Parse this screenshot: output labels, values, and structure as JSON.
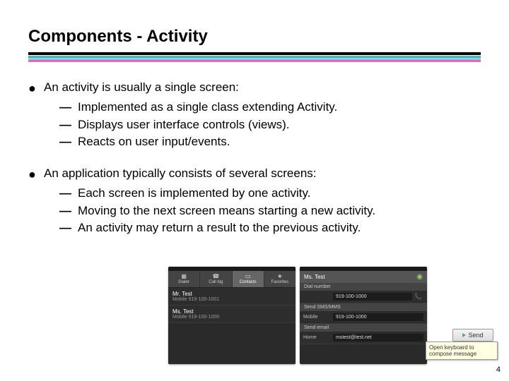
{
  "title": "Components - Activity",
  "bullets": [
    {
      "lead": "An activity is usually a single screen:",
      "subs": [
        "Implemented as a single class extending Activity.",
        "Displays user interface controls (views).",
        "Reacts on user input/events."
      ]
    },
    {
      "lead": "An application typically consists of several screens:",
      "subs": [
        "Each screen is implemented by one activity.",
        "Moving to the next screen means starting a new activity.",
        "An activity may return a result to the previous activity."
      ]
    }
  ],
  "phone_left": {
    "tabs": [
      "Dialer",
      "Call log",
      "Contacts",
      "Favorites"
    ],
    "active_tab": 2,
    "contacts": [
      {
        "name": "Mr. Test",
        "detail": "Mobile 919-100-1001"
      },
      {
        "name": "Ms. Test",
        "detail": "Mobile 919-100-1000"
      }
    ]
  },
  "phone_right": {
    "header": "Ms. Test",
    "sections": {
      "dial": "Dial number",
      "dial_value": "919-100-1000",
      "sms": "Send SMS/MMS",
      "mobile_label": "Mobile",
      "mobile_value": "919-100-1000",
      "email": "Send email",
      "home_label": "Home",
      "home_value": "mstest@test.net"
    }
  },
  "tooltip": "Open keyboard to compose message",
  "send_button": "Send",
  "page_number": "4"
}
